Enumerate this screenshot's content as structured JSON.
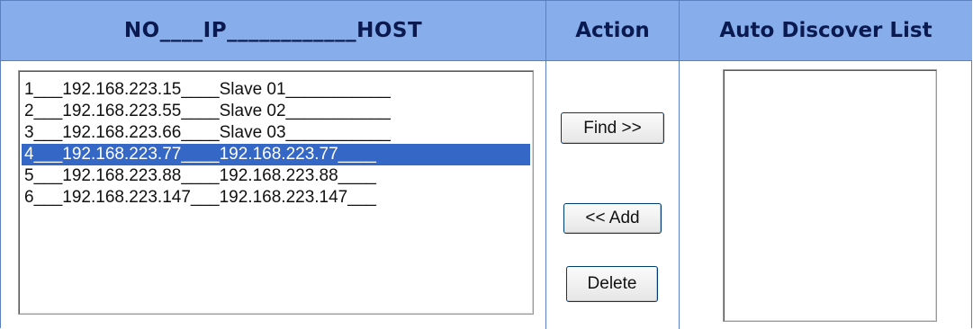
{
  "header": {
    "col_hosts": "NO____IP____________HOST",
    "col_action": "Action",
    "col_auto": "Auto Discover List"
  },
  "host_list": {
    "items": [
      "1___192.168.223.15____Slave 01___________",
      "2___192.168.223.55____Slave 02___________",
      "3___192.168.223.66____Slave 03___________",
      "4___192.168.223.77____192.168.223.77____",
      "5___192.168.223.88____192.168.223.88____",
      "6___192.168.223.147___192.168.223.147___"
    ],
    "selected_index": 3
  },
  "actions": {
    "find_label": "Find >>",
    "add_label": "<< Add",
    "delete_label": "Delete"
  },
  "auto_discover": {
    "items": []
  },
  "colors": {
    "header_bg": "#87aeea",
    "header_text": "#0a1a50",
    "border": "#5b7fbf",
    "selection_bg": "#3568c6",
    "selection_text": "#ffffff"
  }
}
